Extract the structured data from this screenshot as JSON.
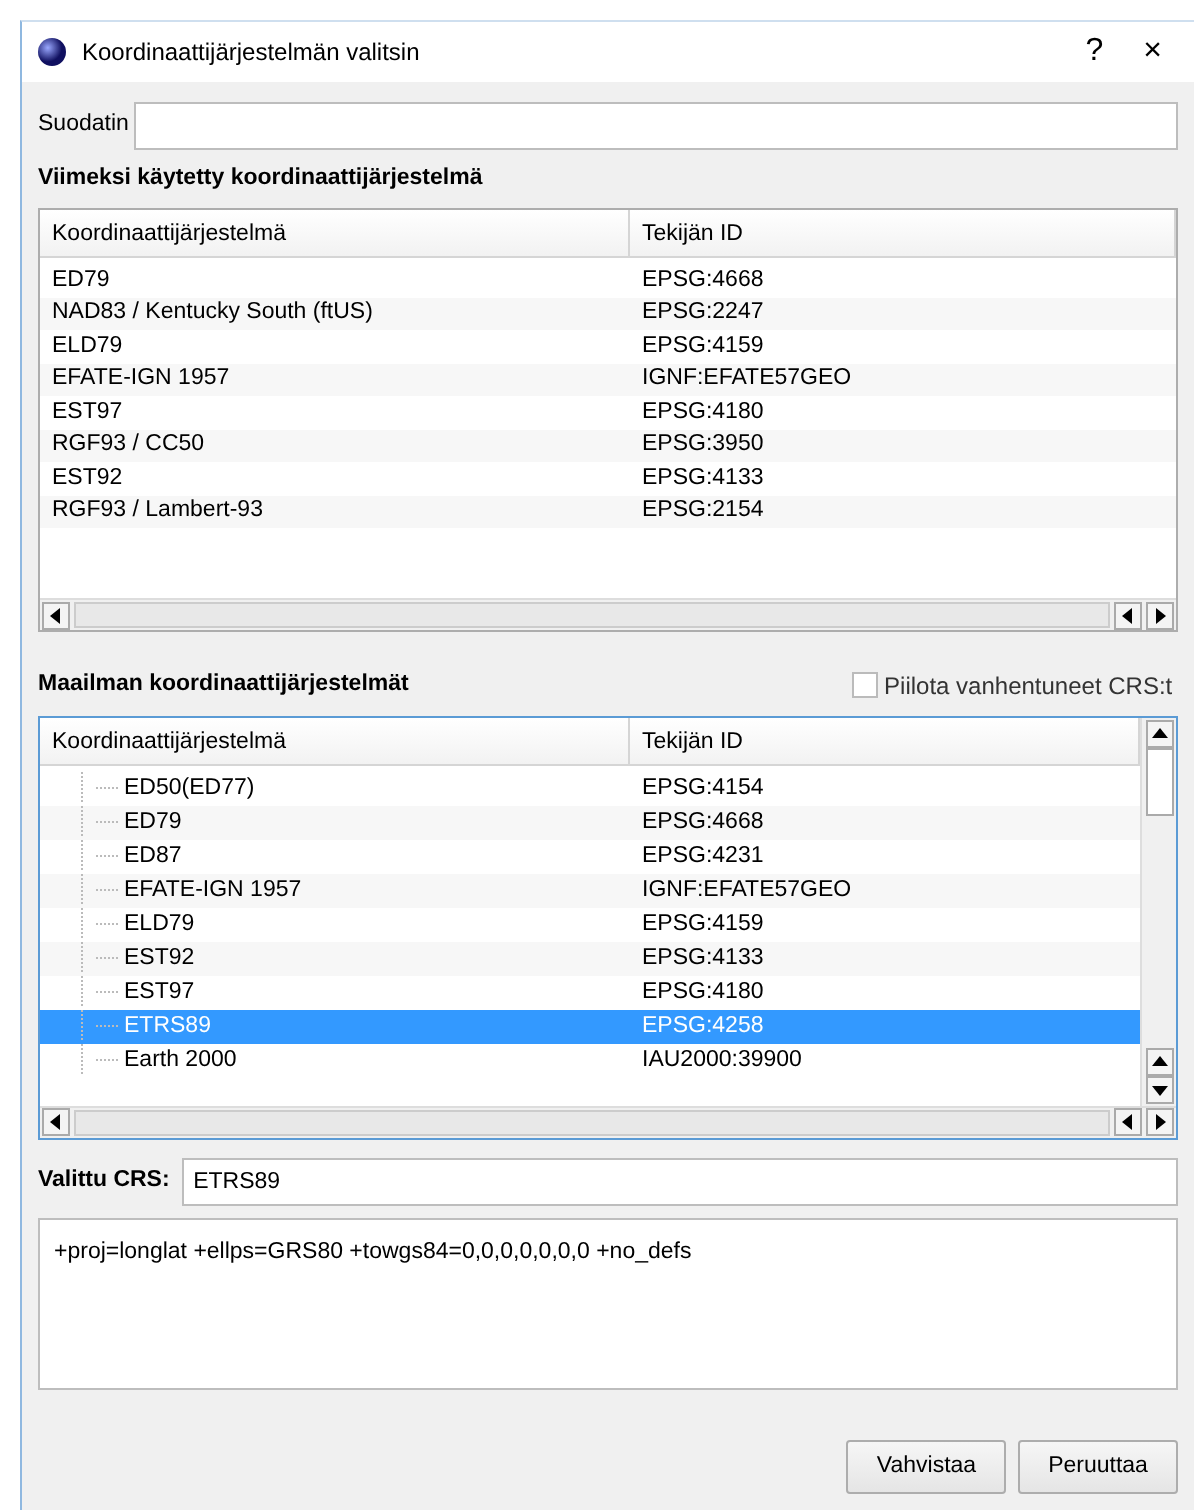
{
  "window": {
    "title": "Koordinaattijärjestelmän valitsin",
    "help": "?",
    "close": "×"
  },
  "filter": {
    "label": "Suodatin"
  },
  "recent": {
    "heading": "Viimeksi käytetty koordinaattijärjestelmä",
    "columns": [
      "Koordinaattijärjestelmä",
      "Tekijän ID"
    ],
    "rows": [
      {
        "name": "ED79",
        "id": "EPSG:4668"
      },
      {
        "name": "NAD83 / Kentucky South (ftUS)",
        "id": "EPSG:2247"
      },
      {
        "name": "ELD79",
        "id": "EPSG:4159"
      },
      {
        "name": "EFATE-IGN 1957",
        "id": "IGNF:EFATE57GEO"
      },
      {
        "name": "EST97",
        "id": "EPSG:4180"
      },
      {
        "name": "RGF93 / CC50",
        "id": "EPSG:3950"
      },
      {
        "name": "EST92",
        "id": "EPSG:4133"
      },
      {
        "name": "RGF93 / Lambert-93",
        "id": "EPSG:2154"
      }
    ]
  },
  "world": {
    "heading": "Maailman koordinaattijärjestelmät",
    "hide_deprecated": {
      "label": "Piilota vanhentuneet CRS:t",
      "checked": false
    },
    "columns": [
      "Koordinaattijärjestelmä",
      "Tekijän ID"
    ],
    "rows": [
      {
        "name": "ED50(ED77)",
        "id": "EPSG:4154",
        "selected": false
      },
      {
        "name": "ED79",
        "id": "EPSG:4668",
        "selected": false
      },
      {
        "name": "ED87",
        "id": "EPSG:4231",
        "selected": false
      },
      {
        "name": "EFATE-IGN 1957",
        "id": "IGNF:EFATE57GEO",
        "selected": false
      },
      {
        "name": "ELD79",
        "id": "EPSG:4159",
        "selected": false
      },
      {
        "name": "EST92",
        "id": "EPSG:4133",
        "selected": false
      },
      {
        "name": "EST97",
        "id": "EPSG:4180",
        "selected": false
      },
      {
        "name": "ETRS89",
        "id": "EPSG:4258",
        "selected": true
      },
      {
        "name": "Earth 2000",
        "id": "IAU2000:39900",
        "selected": false
      }
    ]
  },
  "selected_crs": {
    "label": "Valittu CRS:",
    "value": "ETRS89"
  },
  "proj_definition": "+proj=longlat +ellps=GRS80 +towgs84=0,0,0,0,0,0,0 +no_defs",
  "buttons": [
    "Vahvistaa",
    "Peruuttaa"
  ]
}
